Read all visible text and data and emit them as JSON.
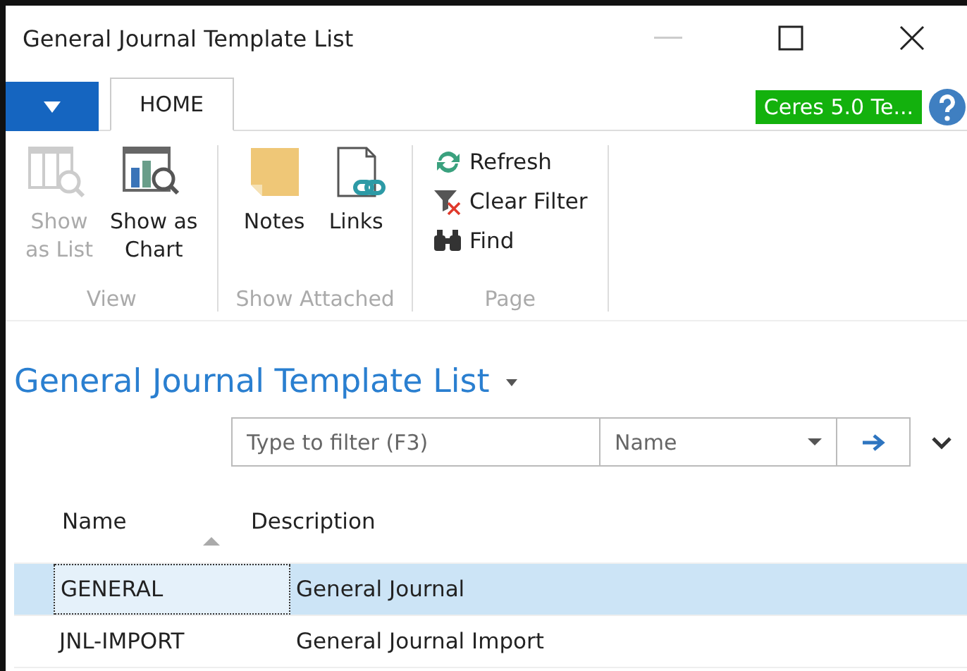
{
  "window": {
    "title": "General Journal Template List"
  },
  "tabs": [
    {
      "label": "HOME",
      "selected": true
    }
  ],
  "company_badge": "Ceres 5.0 Te...",
  "ribbon_groups": [
    {
      "label": "View",
      "actions": [
        {
          "label": "Show\nas List",
          "kind": "list",
          "disabled": true
        },
        {
          "label": "Show as\nChart",
          "kind": "chart",
          "disabled": false
        }
      ]
    },
    {
      "label": "Show Attached",
      "actions": [
        {
          "label": "Notes",
          "kind": "notes",
          "disabled": false
        },
        {
          "label": "Links",
          "kind": "links",
          "disabled": false
        }
      ]
    },
    {
      "label": "Page",
      "actions": [
        {
          "label": "Refresh",
          "kind": "refresh",
          "disabled": false
        },
        {
          "label": "Clear Filter",
          "kind": "clearfilter",
          "disabled": false
        },
        {
          "label": "Find",
          "kind": "find",
          "disabled": false
        }
      ]
    }
  ],
  "page_title": "General Journal Template List",
  "filter": {
    "placeholder": "Type to filter (F3)",
    "field": "Name"
  },
  "table": {
    "columns": [
      "Name",
      "Description"
    ],
    "rows": [
      {
        "name": "GENERAL",
        "description": "General Journal",
        "selected": true
      },
      {
        "name": "JNL-IMPORT",
        "description": "General Journal Import",
        "selected": false
      }
    ]
  }
}
